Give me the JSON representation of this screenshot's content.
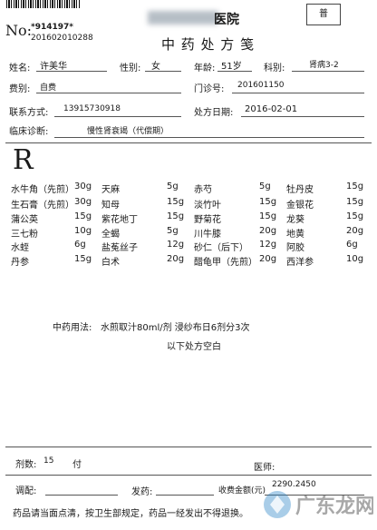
{
  "header": {
    "no_label": "No:",
    "no_value": "*914197*",
    "serial": "201602010288",
    "hospital_suffix": "医院",
    "title": "中 药 处 方 笺",
    "badge": "普"
  },
  "patient": {
    "name_label": "姓名:",
    "name": "许美华",
    "sex_label": "性别:",
    "sex": "女",
    "age_label": "年龄:",
    "age": "51岁",
    "dept_label": "科别:",
    "dept": "肾病3-2",
    "fee_label": "费别:",
    "fee": "自费",
    "clinic_no_label": "门诊号:",
    "clinic_no": "201601150",
    "phone_label": "联系方式:",
    "phone": "13915730918",
    "date_label": "处方日期:",
    "date": "2016-02-01",
    "diagnosis_label": "临床诊断:",
    "diagnosis": "慢性肾衰竭（代偿期）"
  },
  "rx_symbol": "R",
  "medicines": [
    {
      "name": "水牛角（先煎）",
      "dose": "30g"
    },
    {
      "name": "天麻",
      "dose": "5g"
    },
    {
      "name": "赤芍",
      "dose": "5g"
    },
    {
      "name": "牡丹皮",
      "dose": "15g"
    },
    {
      "name": "生石膏（先煎）",
      "dose": "30g"
    },
    {
      "name": "知母",
      "dose": "15g"
    },
    {
      "name": "淡竹叶",
      "dose": "15g"
    },
    {
      "name": "金银花",
      "dose": "15g"
    },
    {
      "name": "蒲公英",
      "dose": "15g"
    },
    {
      "name": "紫花地丁",
      "dose": "15g"
    },
    {
      "name": "野菊花",
      "dose": "15g"
    },
    {
      "name": "龙葵",
      "dose": "15g"
    },
    {
      "name": "三七粉",
      "dose": "10g"
    },
    {
      "name": "全蝎",
      "dose": "5g"
    },
    {
      "name": "川牛膝",
      "dose": "20g"
    },
    {
      "name": "地黄",
      "dose": "20g"
    },
    {
      "name": "水蛭",
      "dose": "6g"
    },
    {
      "name": "盐菟丝子",
      "dose": "12g"
    },
    {
      "name": "砂仁（后下）",
      "dose": "12g"
    },
    {
      "name": "阿胶",
      "dose": "6g"
    },
    {
      "name": "丹参",
      "dose": "15g"
    },
    {
      "name": "白术",
      "dose": "20g"
    },
    {
      "name": "醋龟甲（先煎）",
      "dose": "20g"
    },
    {
      "name": "西洋参",
      "dose": "10g"
    }
  ],
  "usage": {
    "label": "中药用法:",
    "text": "水煎取汁80ml/剂  浸纱布日6剂分3次",
    "blank_note": "以下处方空白"
  },
  "footer": {
    "doses_label": "剂数:",
    "doses": "15",
    "doses_unit": "付",
    "doctor_label": "医师:",
    "dispense_label": "调配:",
    "issue_label": "发药:",
    "amount_label": "收费金额(元)",
    "amount": "2290.2450",
    "notice": "药品请当面点清，按卫生部规定，药品一经发出不得退换。"
  },
  "watermark_text": "广东龙网"
}
